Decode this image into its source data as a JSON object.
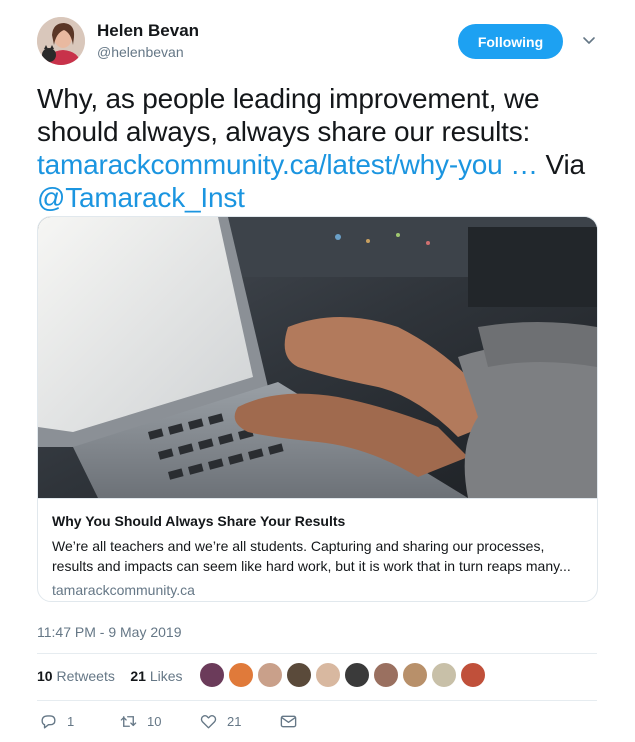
{
  "author": {
    "name": "Helen Bevan",
    "handle": "@helenbevan",
    "follow_label": "Following"
  },
  "tweet": {
    "text_1": "Why, as people leading improvement, we should always, always share our results: ",
    "link_url": "tamarackcommunity.ca/latest/why-you …",
    "text_2": " Via ",
    "mention": "@Tamarack_Inst"
  },
  "card": {
    "title": "Why You Should Always Share Your Results",
    "description": "We’re all teachers and we’re all students. Capturing and sharing our processes, results and impacts can seem like hard work, but it is work that in turn reaps many...",
    "domain": "tamarackcommunity.ca"
  },
  "timestamp": "11:47 PM - 9 May 2019",
  "stats": {
    "retweets_count": "10",
    "retweets_label": "Retweets",
    "likes_count": "21",
    "likes_label": "Likes"
  },
  "actions": {
    "reply_count": "1",
    "retweet_count": "10",
    "like_count": "21"
  },
  "colors": {
    "accent": "#1da1f2",
    "link": "#1b95e0",
    "muted": "#657786"
  }
}
